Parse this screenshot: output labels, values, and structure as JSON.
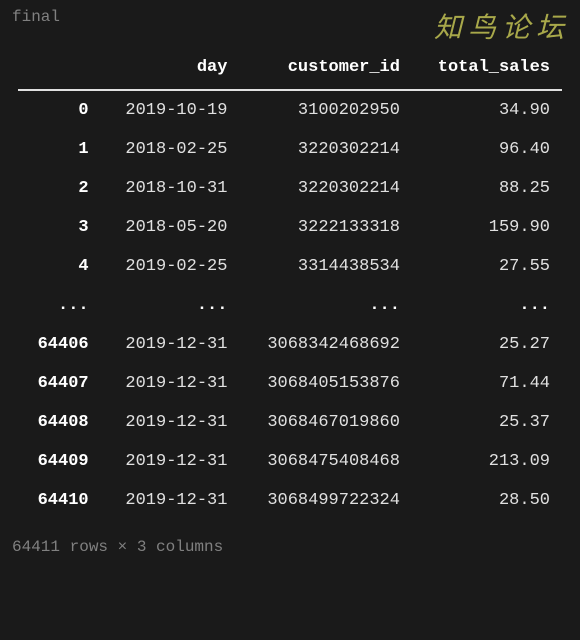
{
  "code_var": "final",
  "watermark": "知鸟论坛",
  "table": {
    "columns": [
      "day",
      "customer_id",
      "total_sales"
    ],
    "rows_top": [
      {
        "idx": "0",
        "day": "2019-10-19",
        "customer_id": "3100202950",
        "total_sales": "34.90"
      },
      {
        "idx": "1",
        "day": "2018-02-25",
        "customer_id": "3220302214",
        "total_sales": "96.40"
      },
      {
        "idx": "2",
        "day": "2018-10-31",
        "customer_id": "3220302214",
        "total_sales": "88.25"
      },
      {
        "idx": "3",
        "day": "2018-05-20",
        "customer_id": "3222133318",
        "total_sales": "159.90"
      },
      {
        "idx": "4",
        "day": "2019-02-25",
        "customer_id": "3314438534",
        "total_sales": "27.55"
      }
    ],
    "ellipsis": {
      "idx": "...",
      "day": "...",
      "customer_id": "...",
      "total_sales": "..."
    },
    "rows_bottom": [
      {
        "idx": "64406",
        "day": "2019-12-31",
        "customer_id": "3068342468692",
        "total_sales": "25.27"
      },
      {
        "idx": "64407",
        "day": "2019-12-31",
        "customer_id": "3068405153876",
        "total_sales": "71.44"
      },
      {
        "idx": "64408",
        "day": "2019-12-31",
        "customer_id": "3068467019860",
        "total_sales": "25.37"
      },
      {
        "idx": "64409",
        "day": "2019-12-31",
        "customer_id": "3068475408468",
        "total_sales": "213.09"
      },
      {
        "idx": "64410",
        "day": "2019-12-31",
        "customer_id": "3068499722324",
        "total_sales": "28.50"
      }
    ]
  },
  "summary": "64411 rows × 3 columns"
}
